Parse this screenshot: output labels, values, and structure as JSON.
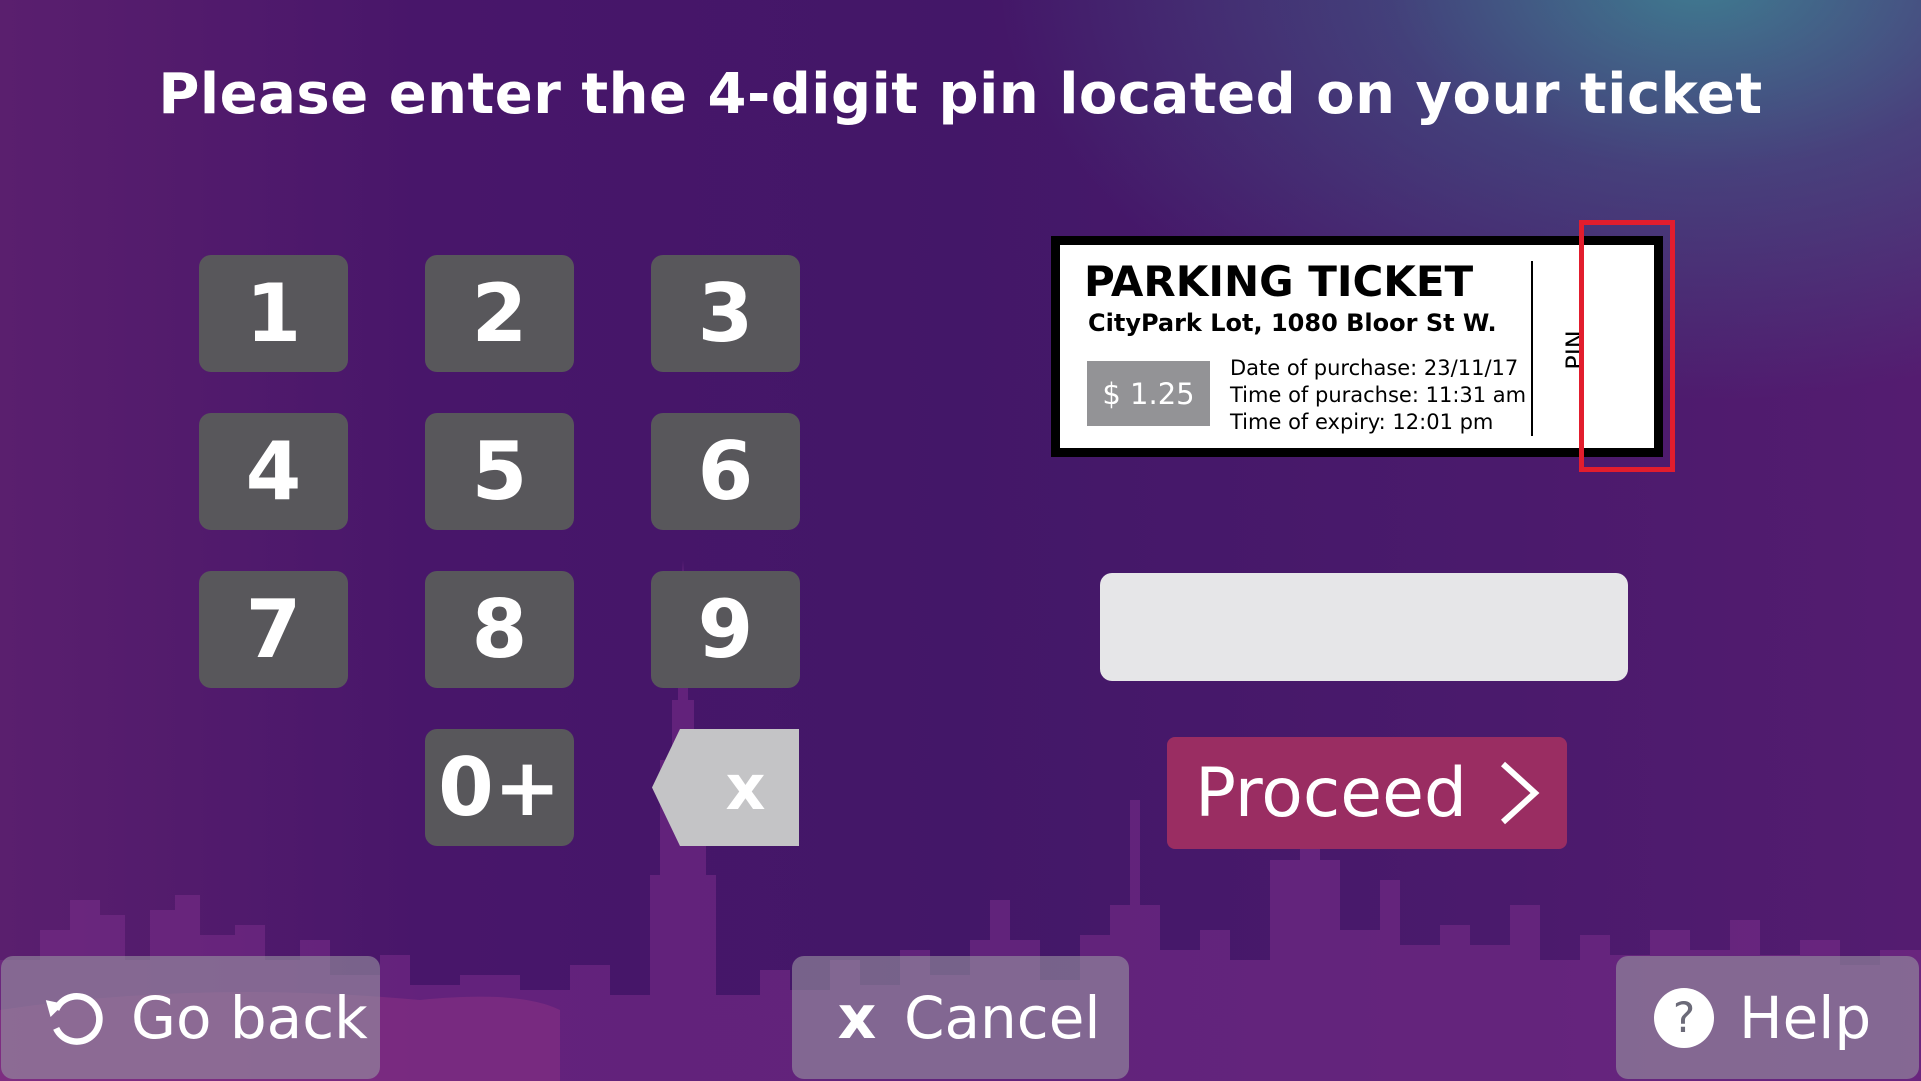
{
  "header": {
    "title": "Please enter the 4-digit pin located on your ticket"
  },
  "keypad": {
    "keys": [
      "1",
      "2",
      "3",
      "4",
      "5",
      "6",
      "7",
      "8",
      "9",
      "0+"
    ],
    "backspace_label": "x"
  },
  "ticket": {
    "title": "PARKING TICKET",
    "location": "CityPark Lot, 1080 Bloor St W.",
    "price": "$ 1.25",
    "date_of_purchase": "Date of purchase: 23/11/17",
    "time_of_purchase": "Time of purachse: 11:31 am",
    "time_of_expiry": "Time of expiry: 12:01 pm",
    "pin_label": "PIN"
  },
  "pin_input": {
    "value": "",
    "placeholder": ""
  },
  "proceed": {
    "label": "Proceed"
  },
  "footer": {
    "back_label": "Go back",
    "cancel_icon": "x",
    "cancel_label": "Cancel",
    "help_icon": "?",
    "help_label": "Help"
  },
  "icons": {
    "back": "refresh-arrow-icon",
    "cancel": "close-icon",
    "help": "question-circle-icon",
    "proceed": "chevron-right-icon",
    "backspace": "backspace-icon"
  },
  "colors": {
    "background": "#48166a",
    "key": "#58575b",
    "backspace": "#c4c4c6",
    "proceed": "#9a2d62",
    "pin_highlight": "#e21d2d",
    "input": "#e6e6e8",
    "skyline": "#7a2a86"
  }
}
